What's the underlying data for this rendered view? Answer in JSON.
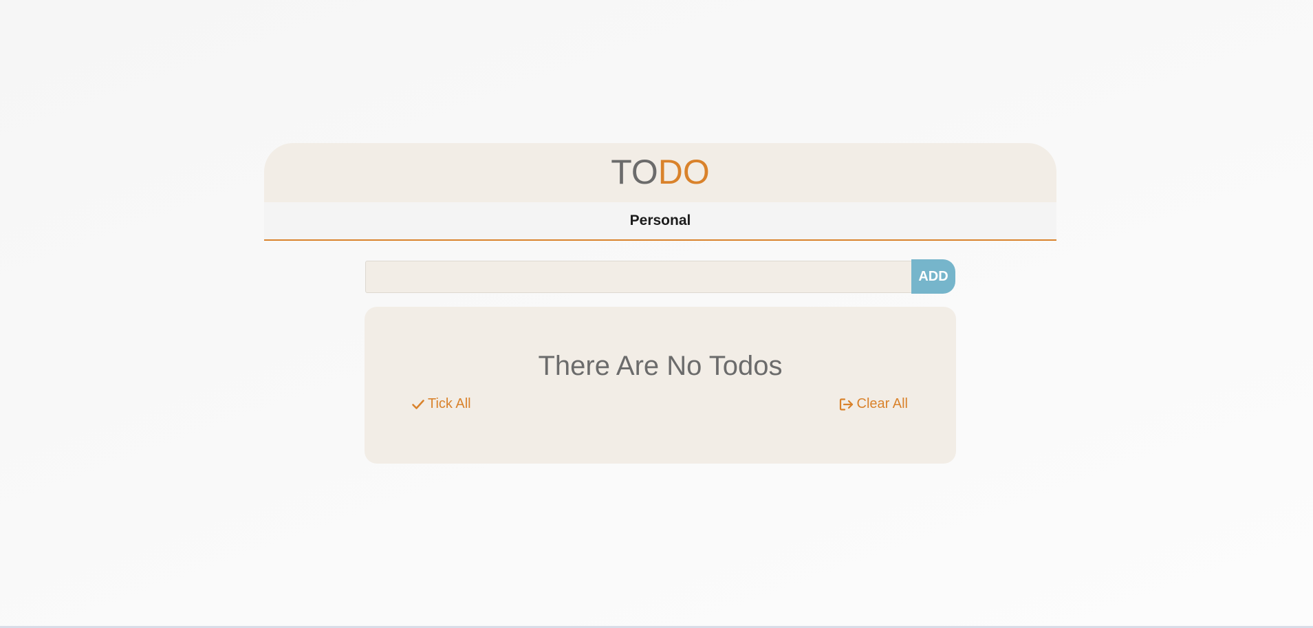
{
  "header": {
    "logo_part1": "TO",
    "logo_part2": "DO"
  },
  "tabs": [
    {
      "label": "Personal"
    }
  ],
  "add_form": {
    "input_value": "",
    "input_placeholder": "",
    "add_label": "ADD"
  },
  "todo_list": {
    "empty_message": "There Are No Todos",
    "tick_all_label": "Tick All",
    "tick_all_icon": "check-icon",
    "clear_all_label": "Clear All",
    "clear_all_icon": "sign-out-icon"
  },
  "colors": {
    "accent": "#d9822b",
    "add_button": "#76b5cb",
    "panel": "#f2ede6",
    "logo_gray": "#6b6b6b"
  }
}
